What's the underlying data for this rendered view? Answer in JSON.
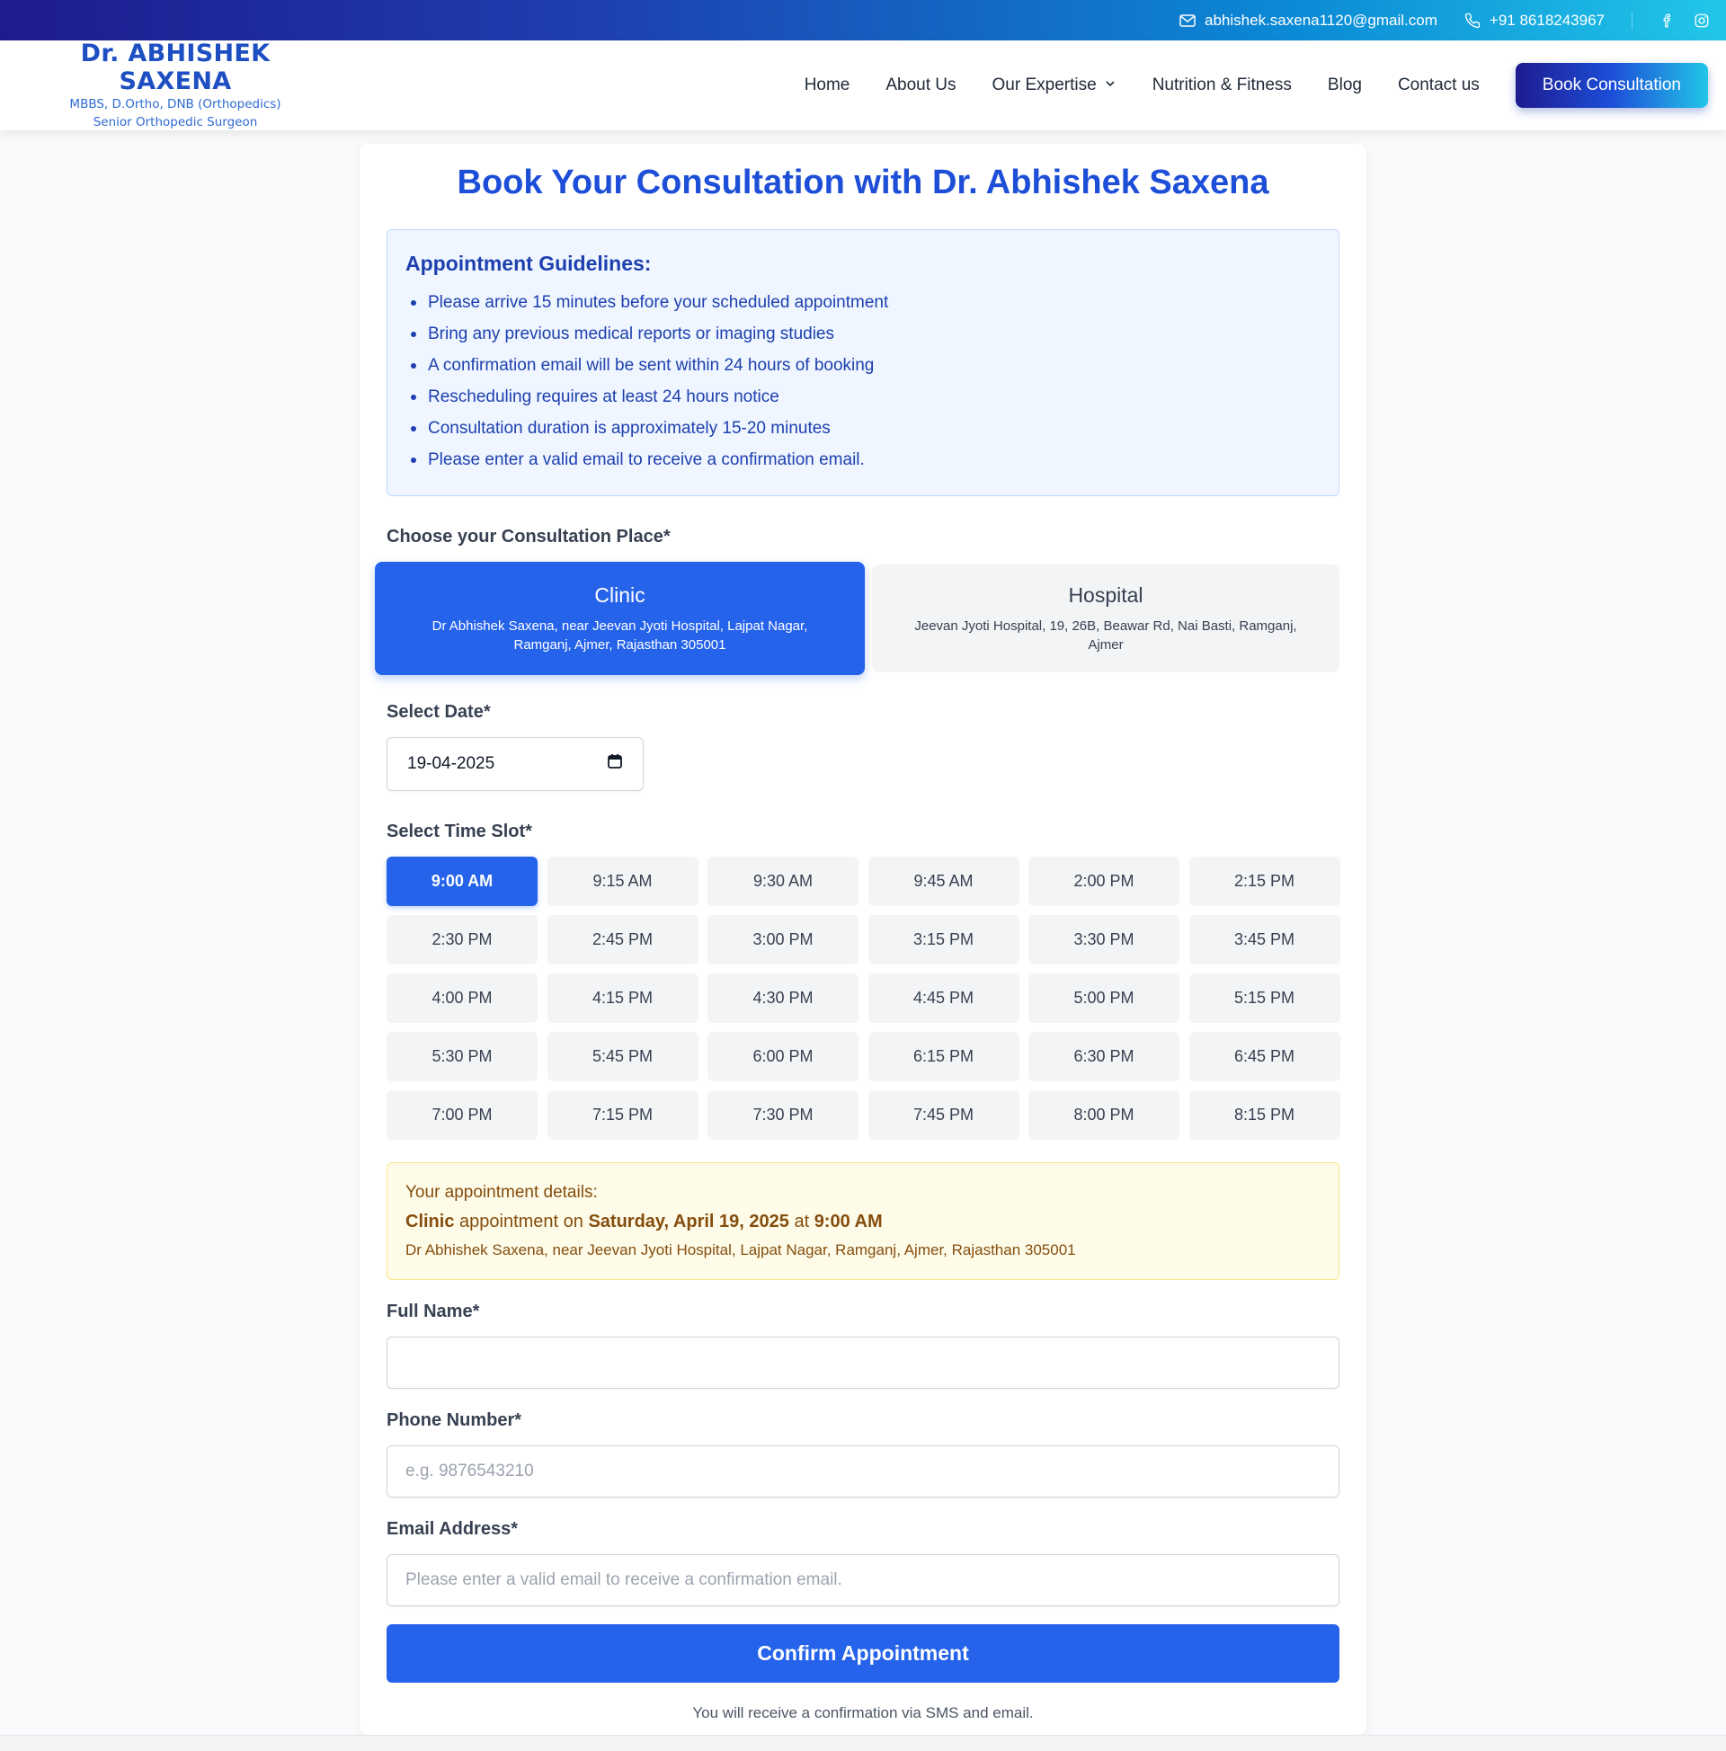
{
  "topbar": {
    "email": "abhishek.saxena1120@gmail.com",
    "phone": "+91 8618243967",
    "icons": [
      "mail-icon",
      "phone-icon",
      "facebook-icon",
      "instagram-icon"
    ]
  },
  "header": {
    "logo_name": "Dr. ABHISHEK SAXENA",
    "logo_sub1": "MBBS, D.Ortho, DNB (Orthopedics)",
    "logo_sub2": "Senior Orthopedic Surgeon",
    "nav": {
      "home": "Home",
      "about": "About Us",
      "expertise": "Our Expertise",
      "nutrition": "Nutrition & Fitness",
      "blog": "Blog",
      "contact": "Contact us"
    },
    "book_button": "Book Consultation"
  },
  "page": {
    "title": "Book Your Consultation with Dr. Abhishek Saxena"
  },
  "guidelines": {
    "heading": "Appointment Guidelines:",
    "items": [
      "Please arrive 15 minutes before your scheduled appointment",
      "Bring any previous medical reports or imaging studies",
      "A confirmation email will be sent within 24 hours of booking",
      "Rescheduling requires at least 24 hours notice",
      "Consultation duration is approximately 15-20 minutes",
      "Please enter a valid email to receive a confirmation email."
    ]
  },
  "place": {
    "label": "Choose your Consultation Place*",
    "options": [
      {
        "name": "Clinic",
        "address": "Dr Abhishek Saxena, near Jeevan Jyoti Hospital, Lajpat Nagar, Ramganj, Ajmer, Rajasthan 305001"
      },
      {
        "name": "Hospital",
        "address": "Jeevan Jyoti Hospital, 19, 26B, Beawar Rd, Nai Basti, Ramganj, Ajmer"
      }
    ],
    "selected": "Clinic"
  },
  "date": {
    "label": "Select Date*",
    "value": "19-04-2025"
  },
  "time": {
    "label": "Select Time Slot*",
    "selected": "9:00 AM",
    "slots": [
      "9:00 AM",
      "9:15 AM",
      "9:30 AM",
      "9:45 AM",
      "2:00 PM",
      "2:15 PM",
      "2:30 PM",
      "2:45 PM",
      "3:00 PM",
      "3:15 PM",
      "3:30 PM",
      "3:45 PM",
      "4:00 PM",
      "4:15 PM",
      "4:30 PM",
      "4:45 PM",
      "5:00 PM",
      "5:15 PM",
      "5:30 PM",
      "5:45 PM",
      "6:00 PM",
      "6:15 PM",
      "6:30 PM",
      "6:45 PM",
      "7:00 PM",
      "7:15 PM",
      "7:30 PM",
      "7:45 PM",
      "8:00 PM",
      "8:15 PM"
    ]
  },
  "details": {
    "heading": "Your appointment details:",
    "place": "Clinic",
    "text1": " appointment on ",
    "date": "Saturday, April 19, 2025",
    "text2": " at ",
    "time": "9:00 AM",
    "address": "Dr Abhishek Saxena, near Jeevan Jyoti Hospital, Lajpat Nagar, Ramganj, Ajmer, Rajasthan 305001"
  },
  "form": {
    "name_label": "Full Name*",
    "name_value": "",
    "phone_label": "Phone Number*",
    "phone_placeholder": "e.g. 9876543210",
    "email_label": "Email Address*",
    "email_placeholder": "Please enter a valid email to receive a confirmation email.",
    "submit": "Confirm Appointment",
    "note": "You will receive a confirmation via SMS and email."
  },
  "colors": {
    "primary": "#2563eb",
    "heading": "#1d4ed8",
    "guideline_bg": "#eff6ff",
    "details_bg": "#fefce8"
  }
}
